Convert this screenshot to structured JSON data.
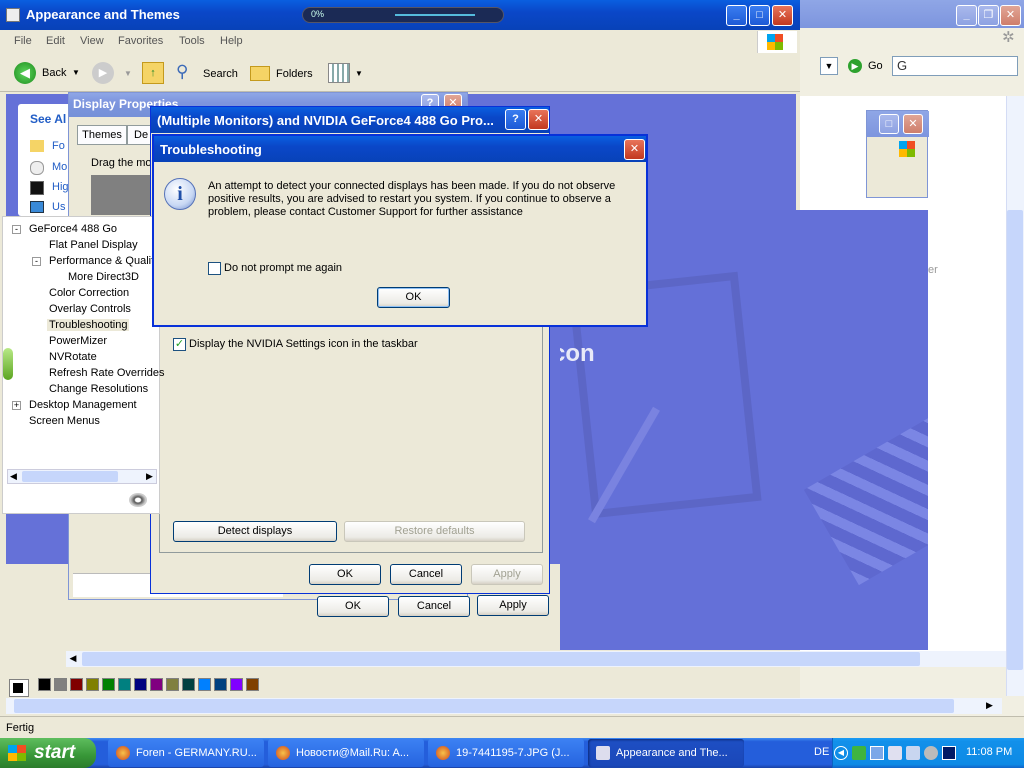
{
  "browser": {
    "title": "Appearance and Themes",
    "menu": [
      "File",
      "Edit",
      "View",
      "Favorites",
      "Tools",
      "Help"
    ],
    "back_label": "Back",
    "search_label": "Search",
    "folders_label": "Folders",
    "go_label": "Go",
    "see_also": "See Al",
    "side_items": [
      "Fo",
      "Mo",
      "Hig",
      "Us"
    ],
    "status": "Fertig"
  },
  "meter": {
    "percent": "0%"
  },
  "display_props": {
    "title": "Display Properties",
    "tabs": [
      "Themes",
      "De"
    ],
    "drag_text": "Drag the mo",
    "ok": "OK",
    "cancel": "Cancel",
    "apply": "Apply"
  },
  "nvidia": {
    "title": "(Multiple Monitors) and NVIDIA GeForce4 488 Go  Pro...",
    "checkbox_label": "Display the NVIDIA Settings icon in the taskbar",
    "checkbox_checked": true,
    "detect": "Detect displays",
    "restore": "Restore defaults",
    "ok": "OK",
    "cancel": "Cancel",
    "apply": "Apply"
  },
  "tree": {
    "root": "GeForce4 488 Go",
    "items": [
      "Flat Panel Display",
      "Performance & Quality",
      "More Direct3D",
      "Color Correction",
      "Overlay Controls",
      "Troubleshooting",
      "PowerMizer",
      "NVRotate",
      "Refresh Rate Overrides",
      "Change Resolutions",
      "Desktop Management",
      "Screen Menus"
    ],
    "selected": "Troubleshooting"
  },
  "bg_text": {
    "icon_word": "con",
    "side_text": "er"
  },
  "dialog": {
    "title": "Troubleshooting",
    "message": "An attempt to detect your connected displays has been made. If you do not observe positive results, you are advised to restart you system. If you continue to observe a problem, please contact Customer Support for further assistance",
    "checkbox_label": "Do not prompt me again",
    "checkbox_checked": false,
    "ok": "OK"
  },
  "palette": [
    "#000000",
    "#808080",
    "#800000",
    "#808000",
    "#008000",
    "#008080",
    "#000080",
    "#800080",
    "#808040",
    "#004040",
    "#0080ff",
    "#004080",
    "#8000ff",
    "#804000"
  ],
  "taskbar": {
    "start": "start",
    "tasks": [
      "Foren - GERMANY.RU...",
      "Новости@Mail.Ru: A...",
      "19-7441195-7.JPG (J...",
      "Appearance and The..."
    ],
    "lang": "DE",
    "clock": "11:08 PM"
  },
  "colors": {
    "xp_blue": "#0a47c8",
    "dialog_face": "#ece9d8",
    "desktop_purple": "#6571d8"
  }
}
